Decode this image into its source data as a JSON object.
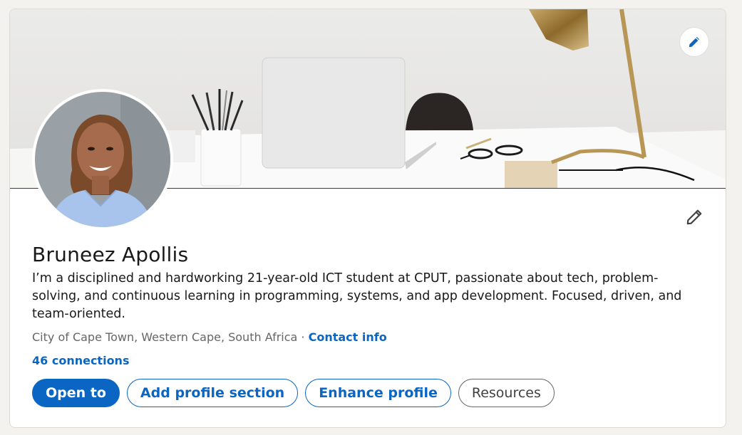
{
  "profile": {
    "name": "Bruneez Apollis",
    "headline": "I’m a disciplined and hardworking 21-year-old ICT student at CPUT, passionate about tech, problem-solving, and continuous learning in programming, systems, and app development. Focused, driven, and team-oriented.",
    "location": "City of Cape Town, Western Cape, South Africa",
    "separator": "·",
    "contact_info": "Contact info",
    "connections": "46 connections"
  },
  "actions": {
    "open_to": "Open to",
    "add_section": "Add profile section",
    "enhance": "Enhance profile",
    "resources": "Resources"
  },
  "icons": {
    "cover_edit": "pencil-icon",
    "intro_edit": "pencil-icon"
  },
  "colors": {
    "brand_blue": "#0a66c2",
    "page_bg": "#f4f2ee",
    "text": "#191919",
    "muted": "#666666"
  }
}
